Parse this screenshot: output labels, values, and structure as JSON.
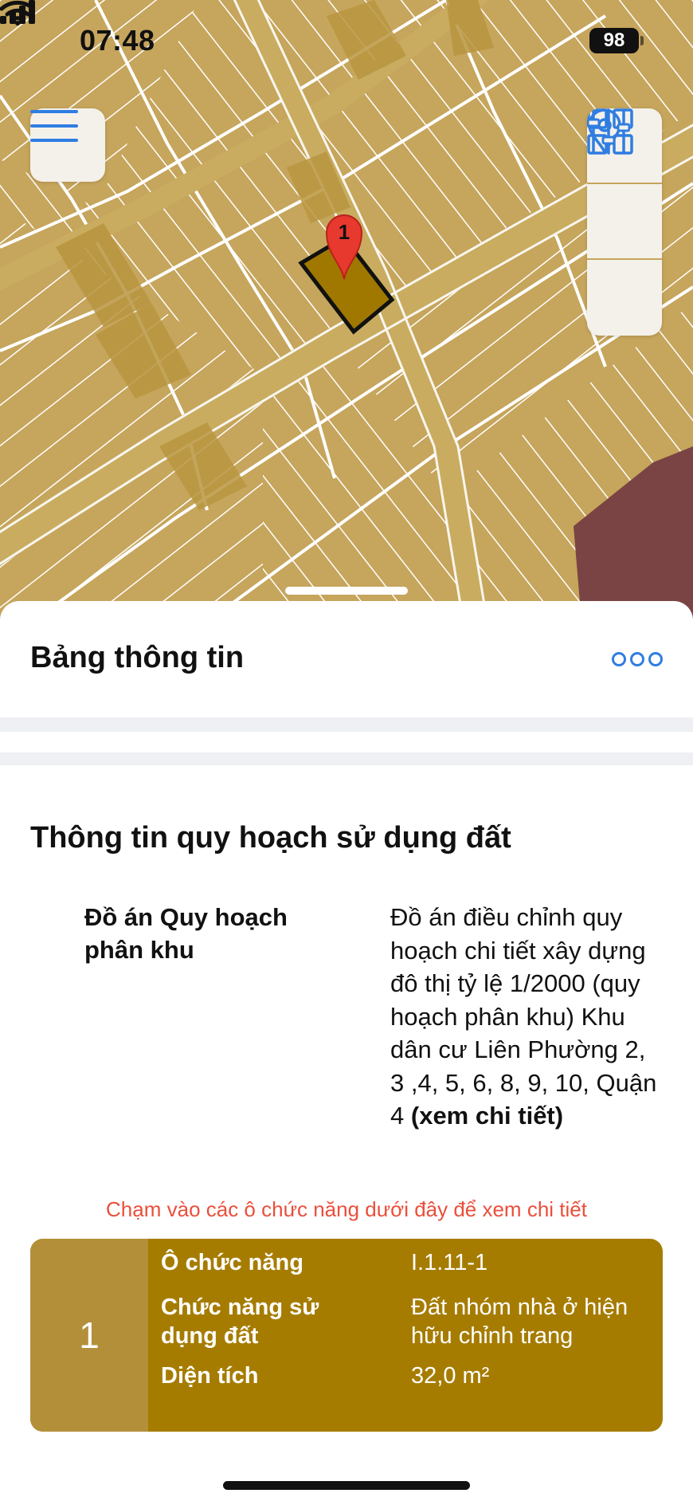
{
  "status_bar": {
    "time": "07:48",
    "battery": "98"
  },
  "map": {
    "marker_label": "1",
    "colors": {
      "land": "#c6a55c",
      "road": "#c9ac60",
      "parcel_line": "#ffffff",
      "building": "#b8953f",
      "selected_parcel": "#a07800",
      "commercial_zone": "#7a4444",
      "marker": "#e8392f"
    }
  },
  "map_controls": {
    "menu_icon": "hamburger-icon",
    "tools": [
      {
        "icon": "grid-icon"
      },
      {
        "icon": "location-pin-icon"
      },
      {
        "icon": "sliders-icon"
      }
    ]
  },
  "panel": {
    "title": "Bảng thông tin",
    "more_icon": "more-icon"
  },
  "planning": {
    "section_title": "Thông tin quy hoạch sử dụng đất",
    "label": "Đồ án Quy hoạch phân khu",
    "value": "Đồ án điều chỉnh quy hoạch chi tiết xây dựng đô thị tỷ lệ 1/2000 (quy hoạch phân khu) Khu dân cư Liên Phường 2, 3 ,4, 5, 6, 8, 9, 10, Quận 4",
    "detail_link": "(xem chi tiết)",
    "hint": "Chạm vào các ô chức năng dưới đây để xem chi tiết"
  },
  "function_card": {
    "index": "1",
    "rows": [
      {
        "label": "Ô chức năng",
        "value": "I.1.11-1"
      },
      {
        "label": "Chức năng sử dụng đất",
        "value": "Đất nhóm nhà ở hiện hữu chỉnh trang"
      },
      {
        "label": "Diện tích",
        "value": "32,0 m²"
      }
    ],
    "colors": {
      "card": "#a67c00",
      "index_cell": "#b38f3a"
    }
  }
}
